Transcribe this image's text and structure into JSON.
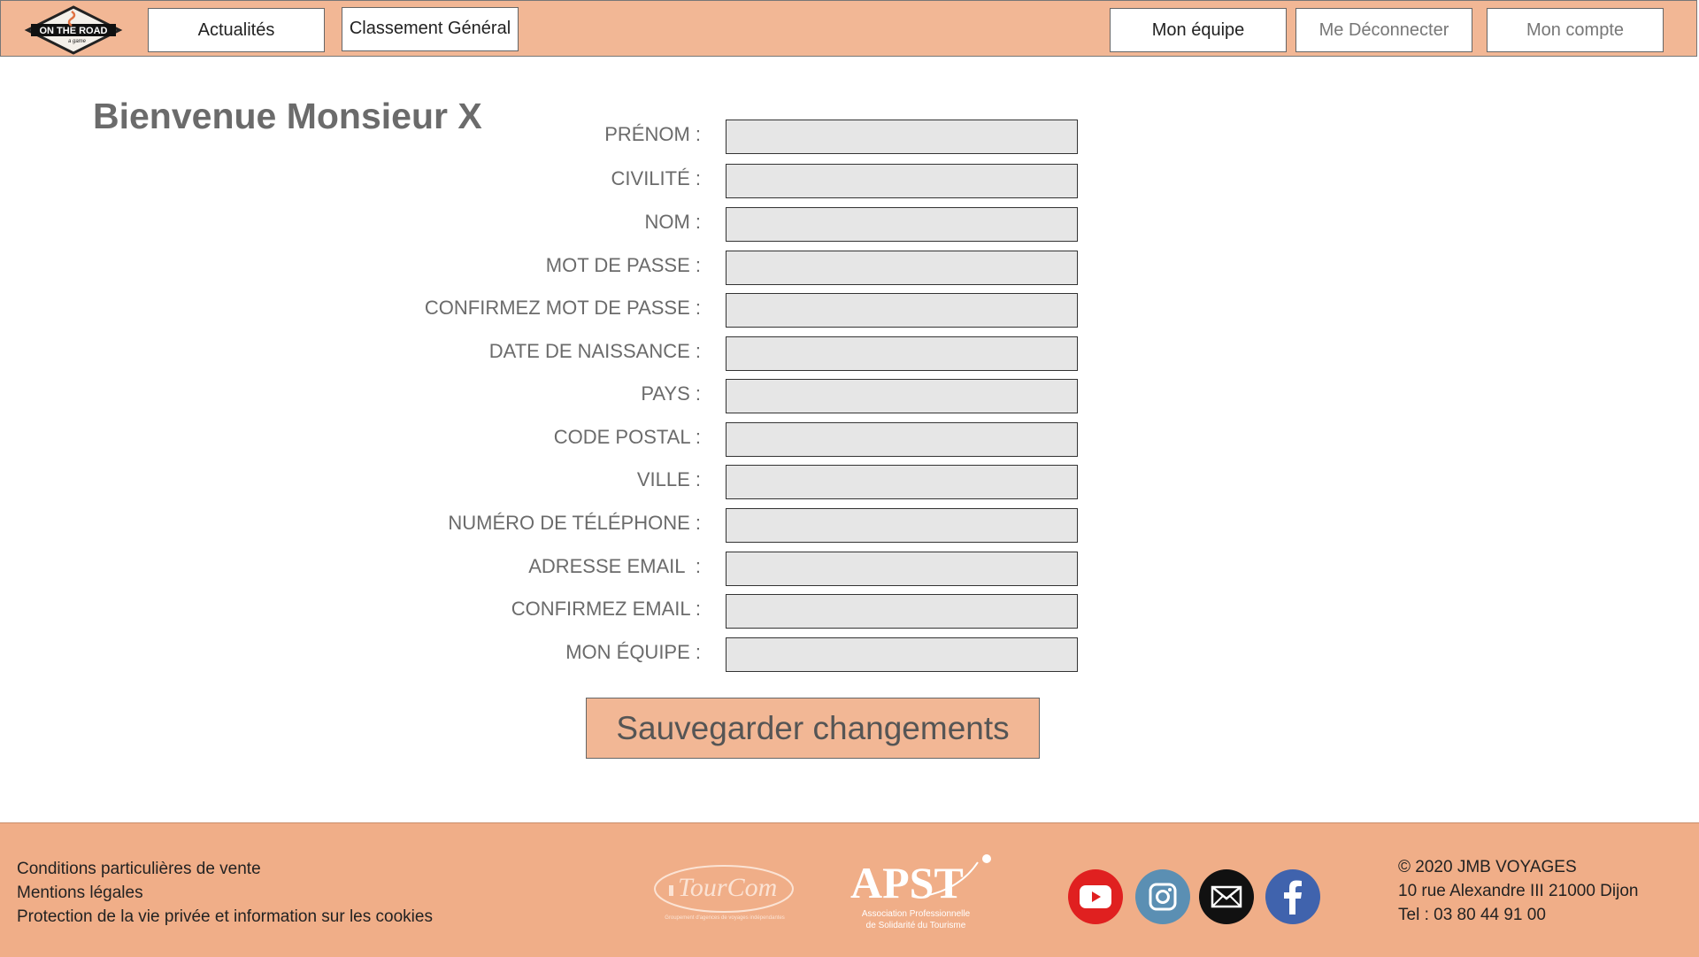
{
  "header": {
    "logo_text": "ON THE ROAD",
    "logo_subtext": "a game",
    "nav_left": [
      "Actualités",
      "Classement Général"
    ],
    "nav_right": [
      "Mon équipe",
      "Me Déconnecter",
      "Mon compte"
    ]
  },
  "main": {
    "welcome": "Bienvenue Monsieur X",
    "fields": [
      {
        "label": "PRÉNOM :",
        "value": ""
      },
      {
        "label": "CIVILITÉ :",
        "value": ""
      },
      {
        "label": "NOM :",
        "value": ""
      },
      {
        "label": "MOT DE PASSE :",
        "value": ""
      },
      {
        "label": "CONFIRMEZ MOT DE PASSE :",
        "value": ""
      },
      {
        "label": "DATE DE NAISSANCE :",
        "value": ""
      },
      {
        "label": "PAYS :",
        "value": ""
      },
      {
        "label": "CODE POSTAL :",
        "value": ""
      },
      {
        "label": "VILLE :",
        "value": ""
      },
      {
        "label": "NUMÉRO DE TÉLÉPHONE :",
        "value": ""
      },
      {
        "label": "ADRESSE EMAIL  :",
        "value": ""
      },
      {
        "label": "CONFIRMEZ EMAIL :",
        "value": ""
      },
      {
        "label": "MON ÉQUIPE :",
        "value": ""
      }
    ],
    "save_label": "Sauvegarder changements"
  },
  "footer": {
    "links": [
      "Conditions particulières de vente",
      "Mentions légales",
      "Protection de la vie privée et information sur les cookies"
    ],
    "tourcom_text": "TourCom",
    "tourcom_sub": "Groupement d'agences de voyages indépendantes",
    "apst_text": "APST",
    "apst_sub1": "Association Professionnelle",
    "apst_sub2": "de Solidarité du Tourisme",
    "socials": [
      {
        "name": "youtube-icon",
        "color": "#e02020"
      },
      {
        "name": "instagram-icon",
        "color": "#5b8fb3"
      },
      {
        "name": "mail-icon",
        "color": "#111111"
      },
      {
        "name": "facebook-icon",
        "color": "#4063ad"
      }
    ],
    "contact": [
      "© 2020 JMB VOYAGES",
      "10 rue Alexandre III 21000 Dijon",
      "Tel : 03 80 44 91 00"
    ]
  }
}
